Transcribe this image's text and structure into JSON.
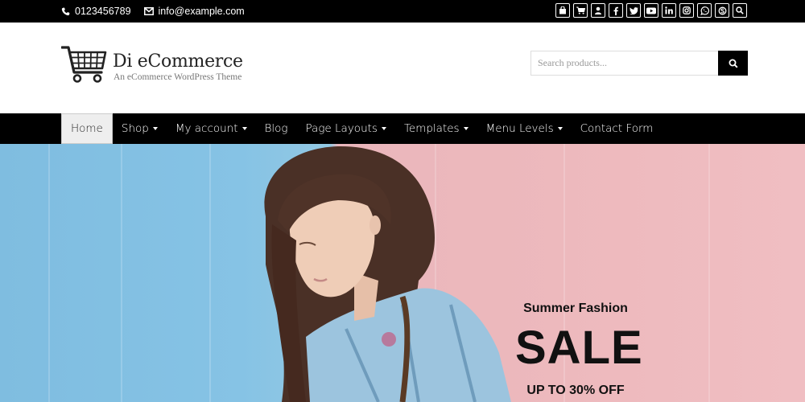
{
  "topbar": {
    "phone": "0123456789",
    "email": "info@example.com",
    "icons": [
      "bag-icon",
      "cart-icon",
      "user-icon",
      "facebook-icon",
      "twitter-icon",
      "youtube-icon",
      "linkedin-icon",
      "instagram-icon",
      "whatsapp-icon",
      "skype-icon",
      "search-icon"
    ]
  },
  "header": {
    "title": "Di eCommerce",
    "tagline": "An eCommerce WordPress Theme",
    "search_placeholder": "Search products..."
  },
  "nav": {
    "items": [
      {
        "label": "Home"
      },
      {
        "label": "Shop"
      },
      {
        "label": "My account"
      },
      {
        "label": "Blog"
      },
      {
        "label": "Page Layouts"
      },
      {
        "label": "Templates"
      },
      {
        "label": "Menu Levels"
      },
      {
        "label": "Contact Form"
      }
    ]
  },
  "hero": {
    "subtitle": "Summer Fashion",
    "headline": "SALE",
    "offer": "UP TO 30% OFF"
  }
}
